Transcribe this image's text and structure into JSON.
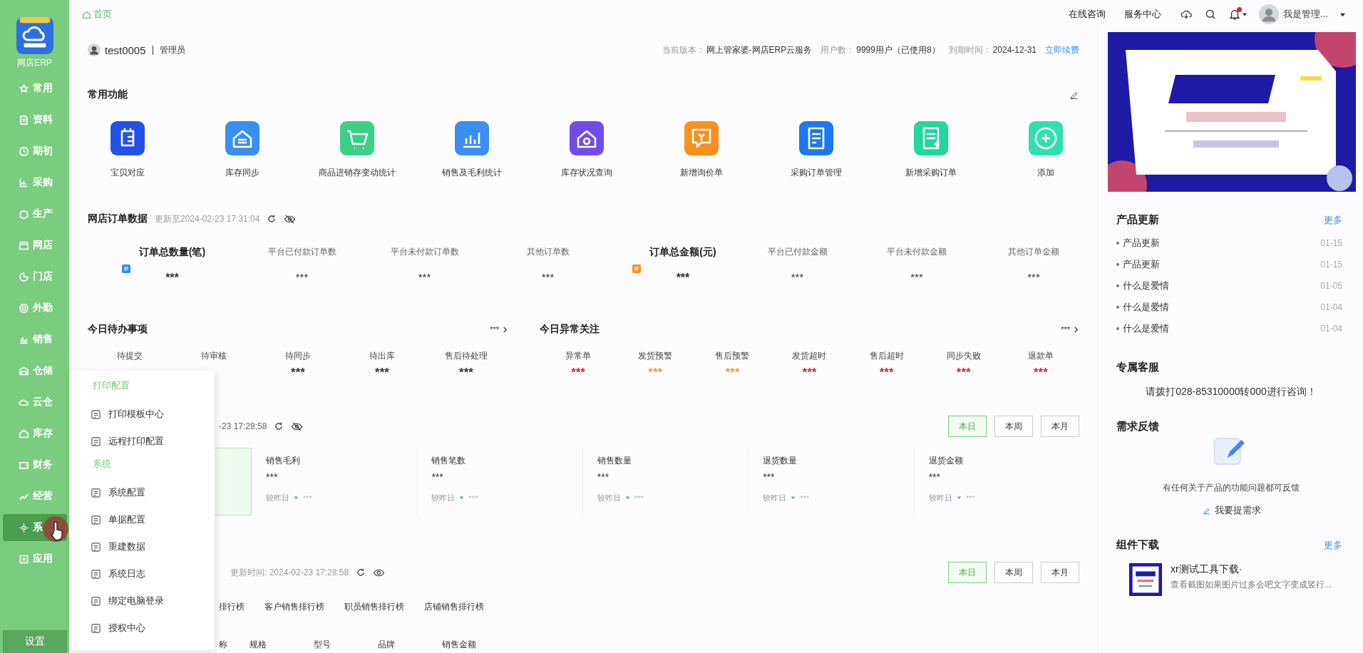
{
  "sidebar": {
    "logo_label": "网店ERP",
    "items": [
      {
        "label": "常用",
        "selected": false
      },
      {
        "label": "资料",
        "selected": false
      },
      {
        "label": "期初",
        "selected": false
      },
      {
        "label": "采购",
        "selected": false
      },
      {
        "label": "生产",
        "selected": false
      },
      {
        "label": "网店",
        "selected": false
      },
      {
        "label": "门店",
        "selected": false
      },
      {
        "label": "外勤",
        "selected": false
      },
      {
        "label": "销售",
        "selected": false
      },
      {
        "label": "仓储",
        "selected": false
      },
      {
        "label": "云仓",
        "selected": false
      },
      {
        "label": "库存",
        "selected": false
      },
      {
        "label": "财务",
        "selected": false
      },
      {
        "label": "经营",
        "selected": false
      },
      {
        "label": "系",
        "selected": true
      },
      {
        "label": "应用",
        "selected": false
      }
    ],
    "footer": "设置"
  },
  "topbar": {
    "breadcrumb": "首页",
    "links": [
      "在线咨询",
      "服务中心"
    ],
    "unread": true,
    "user": "我是管理..."
  },
  "account": {
    "name": "test0005",
    "role": "管理员",
    "info": [
      {
        "label": "当前版本：",
        "value": "网上管家婆-网店ERP云服务"
      },
      {
        "label": "用户数：",
        "value": "9999用户（已使用8）"
      },
      {
        "label": "到期时间：",
        "value": "2024-12-31"
      }
    ],
    "renew": "立即续费"
  },
  "shortcuts": {
    "title": "常用功能",
    "items": [
      {
        "label": "宝贝对应",
        "color": "#2452e6"
      },
      {
        "label": "库存同步",
        "color": "#3a8ef0"
      },
      {
        "label": "商品进销存变动统计",
        "color": "#3ccf86"
      },
      {
        "label": "销售及毛利统计",
        "color": "#3b8ef2"
      },
      {
        "label": "库存状况查询",
        "color": "#6f4ce8"
      },
      {
        "label": "新增询价单",
        "color": "#f7901e"
      },
      {
        "label": "采购订单管理",
        "color": "#1e78ee"
      },
      {
        "label": "新增采购订单",
        "color": "#22d69c"
      },
      {
        "label": "添加",
        "color": "#2ee0b0"
      }
    ]
  },
  "orders": {
    "title": "网店订单数据",
    "updated": "更新至2024-02-23 17:31:04",
    "groups": [
      {
        "title": "订单总数量(笔)",
        "value": "***",
        "color": "#2d8cf0",
        "metrics": [
          {
            "label": "平台已付款订单数",
            "value": "***"
          },
          {
            "label": "平台未付款订单数",
            "value": "***"
          },
          {
            "label": "其他订单数",
            "value": "***"
          }
        ]
      },
      {
        "title": "订单总金额(元)",
        "value": "***",
        "color": "#f7931e",
        "metrics": [
          {
            "label": "平台已付款金额",
            "value": "***"
          },
          {
            "label": "平台未付款金额",
            "value": "***"
          },
          {
            "label": "其他订单金额",
            "value": "***"
          }
        ]
      }
    ]
  },
  "todo": {
    "title": "今日待办事项",
    "more": "***",
    "items": [
      {
        "label": "待提交"
      },
      {
        "label": "待审核"
      },
      {
        "label": "待同步",
        "value": "***"
      },
      {
        "label": "待出库",
        "value": "***"
      },
      {
        "label": "售后待处理",
        "value": "***"
      }
    ]
  },
  "anomaly": {
    "title": "今日异常关注",
    "more": "***",
    "items": [
      {
        "label": "异常单",
        "value": "***",
        "color": "#c0303a"
      },
      {
        "label": "发货预警",
        "value": "***",
        "color": "#e0a53a"
      },
      {
        "label": "售后预警",
        "value": "***",
        "color": "#e0a53a"
      },
      {
        "label": "发货超时",
        "value": "***",
        "color": "#c0303a"
      },
      {
        "label": "售后超时",
        "value": "***",
        "color": "#c0303a"
      },
      {
        "label": "同步失败",
        "value": "***",
        "color": "#c0303a"
      },
      {
        "label": "退款单",
        "value": "***",
        "color": "#c0303a"
      }
    ]
  },
  "sales": {
    "updated": "-23 17:28:58",
    "periods": [
      {
        "label": "本日",
        "selected": true
      },
      {
        "label": "本周",
        "selected": false
      },
      {
        "label": "本月",
        "selected": false
      }
    ],
    "cards": [
      {
        "label": "销售毛利",
        "value": "***",
        "compare": "较昨日",
        "delta": "***"
      },
      {
        "label": "销售笔数",
        "value": "***",
        "compare": "较昨日",
        "delta": "***"
      },
      {
        "label": "销售数量",
        "value": "***",
        "compare": "较昨日",
        "delta": "***"
      },
      {
        "label": "退货数量",
        "value": "***",
        "compare": "较昨日",
        "delta": "***"
      },
      {
        "label": "退货金额",
        "value": "***",
        "compare": "较昨日",
        "delta": "***"
      }
    ]
  },
  "ranking": {
    "updated": "更新时间: 2024-02-23 17:28:58",
    "periods": [
      {
        "label": "本日",
        "selected": true
      },
      {
        "label": "本周",
        "selected": false
      },
      {
        "label": "本月",
        "selected": false
      }
    ],
    "tabs": [
      "排行榜",
      "客户销售排行榜",
      "职员销售排行榜",
      "店铺销售排行榜"
    ],
    "columns": [
      "称",
      "规格",
      "型号",
      "品牌",
      "销售金额"
    ]
  },
  "popup_menu": {
    "groups": [
      {
        "title": "打印配置",
        "items": [
          "打印模板中心",
          "远程打印配置"
        ]
      },
      {
        "title": "系统",
        "items": [
          "系统配置",
          "单据配置",
          "重建数据",
          "系统日志",
          "绑定电脑登录",
          "授权中心"
        ]
      }
    ]
  },
  "news": {
    "title": "产品更新",
    "more": "更多",
    "items": [
      {
        "title": "产品更新",
        "date": "01-15"
      },
      {
        "title": "产品更新",
        "date": "01-15"
      },
      {
        "title": "什么是爱情",
        "date": "01-05"
      },
      {
        "title": "什么是爱情",
        "date": "01-04"
      },
      {
        "title": "什么是爱情",
        "date": "01-04"
      }
    ]
  },
  "service": {
    "title": "专属客服",
    "text": "请拨打028-85310000转000进行咨询！"
  },
  "feedback": {
    "title": "需求反馈",
    "text": "有任何关于产品的功能问题都可反馈",
    "button": "我要提需求"
  },
  "downloads": {
    "title": "组件下载",
    "more": "更多",
    "items": [
      {
        "title": "xr测试工具下载·",
        "desc": "查看截图如果图片过多会吧文字变成竖行..."
      }
    ]
  }
}
